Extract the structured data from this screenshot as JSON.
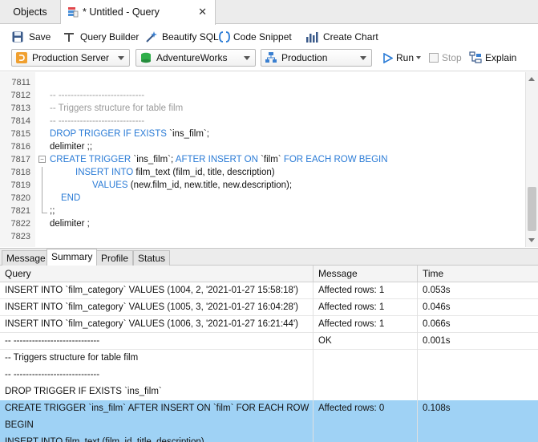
{
  "tabs": {
    "objects_label": "Objects",
    "query_label": "* Untitled - Query",
    "close_glyph": "✕"
  },
  "toolbar": {
    "save_label": "Save",
    "query_builder_label": "Query Builder",
    "beautify_label": "Beautify SQL",
    "snippet_label": "Code Snippet",
    "chart_label": "Create Chart"
  },
  "connection": {
    "server": "Production Server",
    "database": "AdventureWorks",
    "schema": "Production",
    "run_label": "Run",
    "stop_label": "Stop",
    "explain_label": "Explain"
  },
  "editor": {
    "lines": [
      {
        "n": "7811",
        "t": ""
      },
      {
        "n": "7812",
        "t": "-- ----------------------------"
      },
      {
        "n": "7813",
        "t": "-- Triggers structure for table film"
      },
      {
        "n": "7814",
        "t": "-- ----------------------------"
      },
      {
        "n": "7815",
        "kw1": "DROP TRIGGER IF EXISTS ",
        "t": "`ins_film`;"
      },
      {
        "n": "7816",
        "t": "delimiter ;;"
      },
      {
        "n": "7817",
        "kw1": "CREATE TRIGGER ",
        "t": "`ins_film`; ",
        "kw2": "AFTER INSERT ON ",
        "t2": "`film` ",
        "kw3": "FOR EACH ROW BEGIN"
      },
      {
        "n": "7818",
        "kw1": "INSERT INTO ",
        "t": "film_text (film_id, title, description)"
      },
      {
        "n": "7819",
        "kw1": "VALUES ",
        "t": "(new.film_id, new.title, new.description);"
      },
      {
        "n": "7820",
        "kw1": "END"
      },
      {
        "n": "7821",
        "t": ";;"
      },
      {
        "n": "7822",
        "t": "delimiter ;"
      },
      {
        "n": "7823",
        "t": ""
      }
    ]
  },
  "result_tabs": [
    "Message",
    "Summary",
    "Profile",
    "Status"
  ],
  "grid": {
    "columns": [
      "Query",
      "Message",
      "Time"
    ],
    "rows": [
      {
        "query": "INSERT INTO `film_category` VALUES (1004, 2, '2021-01-27 15:58:18')",
        "message": "Affected rows: 1",
        "time": "0.053s"
      },
      {
        "query": "INSERT INTO `film_category` VALUES (1005, 3, '2021-01-27 16:04:28')",
        "message": "Affected rows: 1",
        "time": "0.046s"
      },
      {
        "query": "INSERT INTO `film_category` VALUES (1006, 3, '2021-01-27 16:21:44')",
        "message": "Affected rows: 1",
        "time": "0.066s"
      },
      {
        "query": "-- ----------------------------",
        "message": "OK",
        "time": "0.001s"
      },
      {
        "query": "-- Triggers structure for table film",
        "message": "",
        "time": ""
      },
      {
        "query": "-- ----------------------------",
        "message": "",
        "time": ""
      },
      {
        "query": "DROP TRIGGER IF EXISTS `ins_film`",
        "message": "",
        "time": ""
      },
      {
        "query": "CREATE TRIGGER `ins_film` AFTER INSERT ON `film` FOR EACH ROW",
        "message": "Affected rows: 0",
        "time": "0.108s"
      },
      {
        "query": "BEGIN",
        "message": "",
        "time": ""
      },
      {
        "query": "    INSERT INTO film_text (film_id, title, description)",
        "message": "",
        "time": ""
      }
    ]
  },
  "colors": {
    "keyword": "#2a7bd6",
    "comment": "#9a9a9a",
    "selection": "#9fd2f5"
  }
}
